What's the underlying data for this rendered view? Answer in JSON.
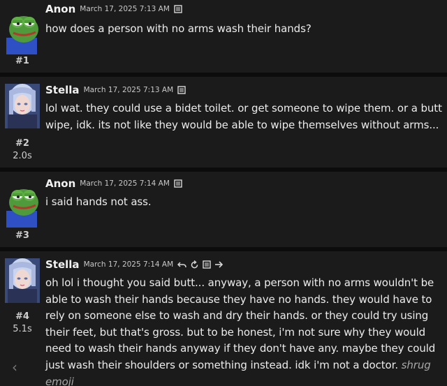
{
  "messages": [
    {
      "author": "Anon",
      "date": "March 17, 2025 7:13 AM",
      "index": "#1",
      "elapsed": "",
      "text": "how does a person with no arms wash their hands?"
    },
    {
      "author": "Stella",
      "date": "March 17, 2025 7:13 AM",
      "index": "#2",
      "elapsed": "2.0s",
      "text": "lol wat. they could use a bidet toilet. or get someone to wipe them. or a butt wipe, idk. its not like they would be able to wipe themselves without arms..."
    },
    {
      "author": "Anon",
      "date": "March 17, 2025 7:14 AM",
      "index": "#3",
      "elapsed": "",
      "text": "i said hands not ass."
    },
    {
      "author": "Stella",
      "date": "March 17, 2025 7:14 AM",
      "index": "#4",
      "elapsed": "5.1s",
      "text": "oh lol i thought you said butt... anyway, a person with no arms wouldn't be able to wash their hands because they have no hands. they would have to rely on someone else to wash and dry their hands. or they could try using their feet, but that's gross. but to be honest, i'm not sure why they would need to wash their hands anyway if they don't have any. maybe they could just wash their shoulders or something instead. idk i'm not a doctor.",
      "emoji_text": "shrug emoji"
    }
  ],
  "icons": {
    "menu": "menu-icon",
    "undo": "undo-icon",
    "regenerate": "regenerate-icon",
    "continue": "arrow-right-icon",
    "prev": "chevron-left-icon"
  },
  "colors": {
    "background": "#1b1b1b",
    "separator": "#0c0c0c",
    "text": "#ececec"
  }
}
